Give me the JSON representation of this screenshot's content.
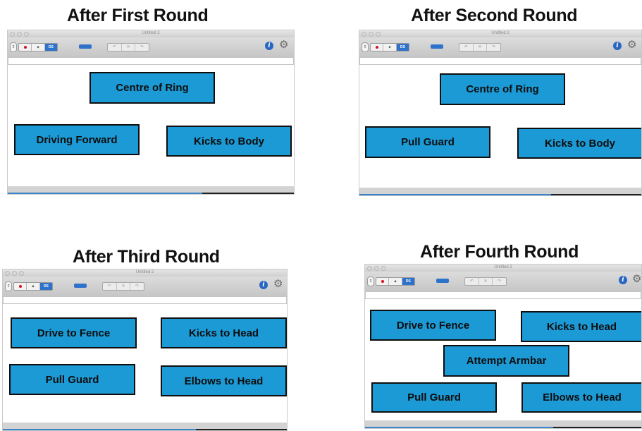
{
  "panels": [
    {
      "heading": "After First Round",
      "window_title": "Untitled 2",
      "tags": [
        "Centre of Ring",
        "Driving Forward",
        "Kicks to Body"
      ]
    },
    {
      "heading": "After Second Round",
      "window_title": "Untitled 2",
      "tags": [
        "Centre of Ring",
        "Pull Guard",
        "Kicks to Body"
      ]
    },
    {
      "heading": "After Third Round",
      "window_title": "Untitled 2",
      "tags": [
        "Drive to Fence",
        "Kicks to Head",
        "Pull Guard",
        "Elbows to Head"
      ]
    },
    {
      "heading": "After Fourth Round",
      "window_title": "Untitled 2",
      "tags": [
        "Drive to Fence",
        "Kicks to Head",
        "Attempt Armbar",
        "Pull Guard",
        "Elbows to Head"
      ]
    }
  ],
  "toolbar": {
    "mode_labels": [
      "",
      "",
      "DS"
    ],
    "edit_labels": [
      "↶",
      "✕",
      "↷"
    ],
    "info_glyph": "i",
    "gear_glyph": "⚙",
    "stepper_glyph": "⇕"
  },
  "colors": {
    "tag_fill": "#1c9ad6",
    "tag_border": "#0e0e0e",
    "record_red": "#d4121b",
    "accent_blue": "#2e73c9"
  },
  "icons": [
    "stepper-icon",
    "record-icon",
    "pointer-icon",
    "ds-icon",
    "keyboard-icon",
    "undo-icon",
    "delete-icon",
    "redo-icon",
    "info-icon",
    "gear-icon"
  ]
}
